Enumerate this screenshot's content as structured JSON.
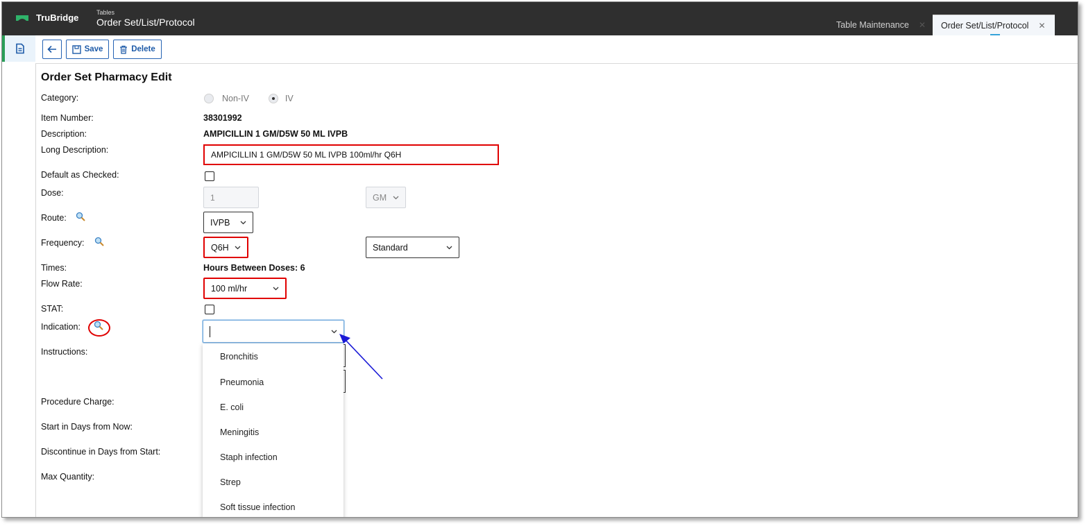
{
  "app": {
    "brand": "TruBridge",
    "context_small": "Tables",
    "context_title": "Order Set/List/Protocol"
  },
  "tabs": [
    {
      "label": "Table Maintenance",
      "active": false
    },
    {
      "label": "Order Set/List/Protocol",
      "active": true
    }
  ],
  "toolbar": {
    "save_label": "Save",
    "delete_label": "Delete"
  },
  "form": {
    "title": "Order Set Pharmacy Edit",
    "category_label": "Category:",
    "category_options": [
      "Non-IV",
      "IV"
    ],
    "category_selected": "IV",
    "item_number_label": "Item Number:",
    "item_number": "38301992",
    "description_label": "Description:",
    "description": "AMPICILLIN 1 GM/D5W 50 ML IVPB",
    "long_description_label": "Long Description:",
    "long_description": "AMPICILLIN 1 GM/D5W 50 ML IVPB 100ml/hr Q6H",
    "default_checked_label": "Default as Checked:",
    "dose_label": "Dose:",
    "dose_value": "1",
    "dose_unit": "GM",
    "route_label": "Route:",
    "route_value": "IVPB",
    "frequency_label": "Frequency:",
    "frequency_value": "Q6H",
    "frequency_schedule": "Standard",
    "times_label": "Times:",
    "times_value": "Hours Between Doses: 6",
    "flow_rate_label": "Flow Rate:",
    "flow_rate_value": "100 ml/hr",
    "stat_label": "STAT:",
    "indication_label": "Indication:",
    "instructions_label": "Instructions:",
    "procedure_charge_label": "Procedure Charge:",
    "start_days_label": "Start in Days from Now:",
    "discontinue_label": "Discontinue in Days from Start:",
    "max_quantity_label": "Max Quantity:"
  },
  "indication_options": [
    "Bronchitis",
    "Pneumonia",
    "E. coli",
    "Meningitis",
    "Staph infection",
    "Strep",
    "Soft tissue infection"
  ],
  "colors": {
    "topbar": "#2f2f2f",
    "accent_blue": "#1d5aa8",
    "highlight_red": "#e00000",
    "brand_green": "#2a9e57"
  }
}
